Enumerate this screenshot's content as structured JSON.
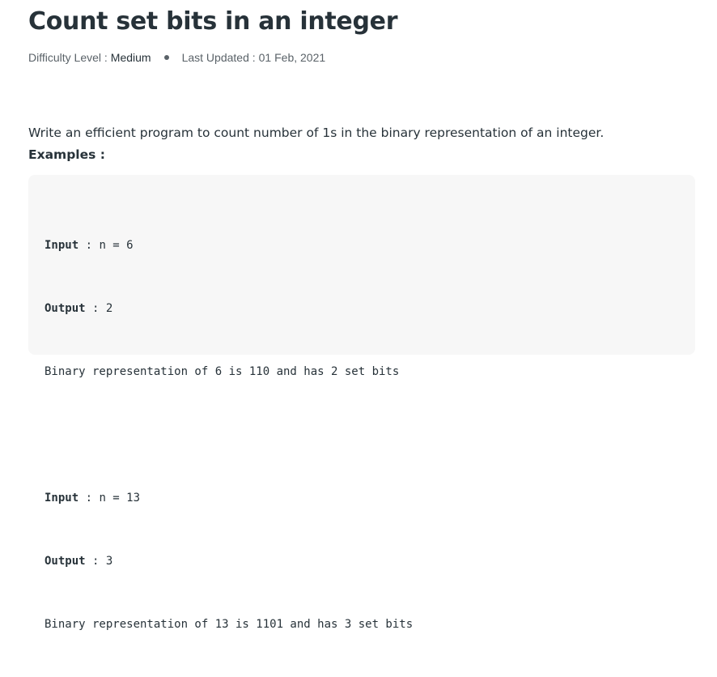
{
  "article": {
    "title": "Count set bits in an integer",
    "difficulty_label": "Difficulty Level :",
    "difficulty_value": "Medium",
    "updated_label": "Last Updated :",
    "updated_value": "01 Feb, 2021"
  },
  "content": {
    "intro": "Write an efficient program to count number of 1s in the binary representation of an integer.",
    "examples_heading": "Examples :"
  },
  "examples": [
    {
      "input_label": "Input",
      "input_value": " : n = 6",
      "output_label": "Output",
      "output_value": " : 2",
      "explanation": "Binary representation of 6 is 110 and has 2 set bits"
    },
    {
      "input_label": "Input",
      "input_value": " : n = 13",
      "output_label": "Output",
      "output_value": " : 3",
      "explanation": "Binary representation of 13 is 1101 and has 3 set bits"
    }
  ]
}
